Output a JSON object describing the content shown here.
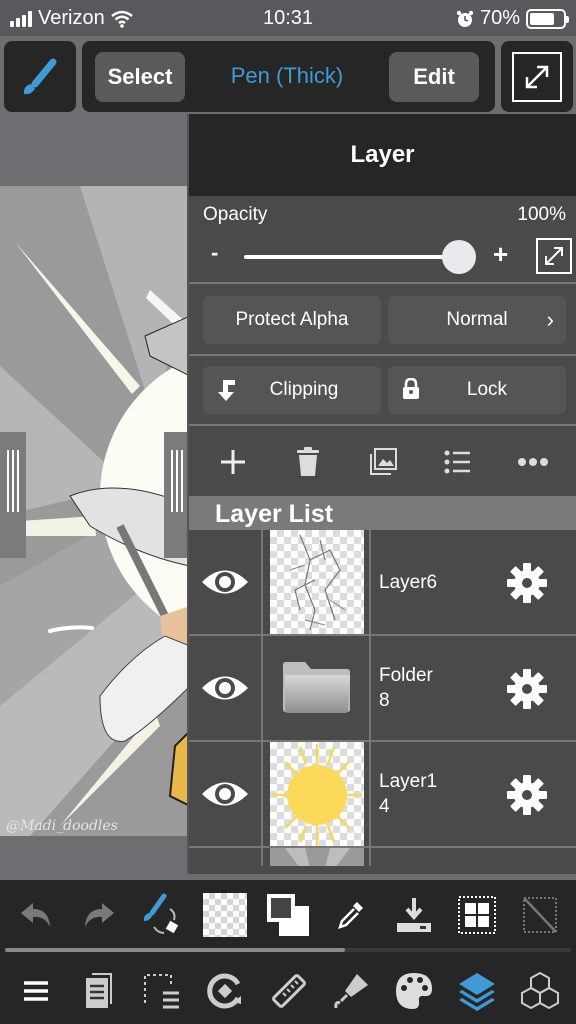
{
  "status_bar": {
    "carrier": "Verizon",
    "time": "10:31",
    "battery": "70%",
    "battery_level": 0.7
  },
  "top_bar": {
    "brush_icon": "brush-icon",
    "select_label": "Select",
    "tool_name": "Pen (Thick)",
    "edit_label": "Edit",
    "expand_icon": "expand-arrows-icon",
    "accent_color": "#3f9ad6"
  },
  "layer_panel": {
    "title": "Layer",
    "opacity_label": "Opacity",
    "opacity_value": "100%",
    "opacity_fraction": 1.0,
    "minus_label": "-",
    "plus_label": "+",
    "protect_alpha_label": "Protect Alpha",
    "blend_mode": "Normal",
    "clipping_label": "Clipping",
    "lock_label": "Lock",
    "actions": [
      "add-layer-icon",
      "delete-icon",
      "import-image-icon",
      "list-icon",
      "more-icon"
    ],
    "layer_list_label": "Layer List",
    "layers": [
      {
        "name": "Layer6",
        "visible": true,
        "type": "layer",
        "thumb": "sketch"
      },
      {
        "name": "Folder 8",
        "line1": "Folder",
        "line2": "8",
        "visible": true,
        "type": "folder"
      },
      {
        "name": "Layer1 4",
        "line1": "Layer1",
        "line2": "4",
        "visible": true,
        "type": "layer",
        "thumb": "sun"
      },
      {
        "name": "",
        "visible": null,
        "type": "layer",
        "thumb": "rays",
        "partial": true
      }
    ]
  },
  "canvas": {
    "watermark": "@Madi_doodles"
  },
  "bottom_toolbar": {
    "row1": [
      "undo-icon",
      "redo-icon",
      "brush-swap-icon",
      "transparent-color-swatch",
      "color-fg-bg-icon",
      "eyedropper-icon",
      "download-icon",
      "grid-select-icon",
      "deselect-icon"
    ],
    "row2": [
      "menu-icon",
      "pages-icon",
      "selection-layer-icon",
      "rotate-icon",
      "ruler-icon",
      "fill-icon",
      "palette-icon",
      "layers-icon",
      "materials-icon"
    ],
    "active": "layers-icon"
  }
}
